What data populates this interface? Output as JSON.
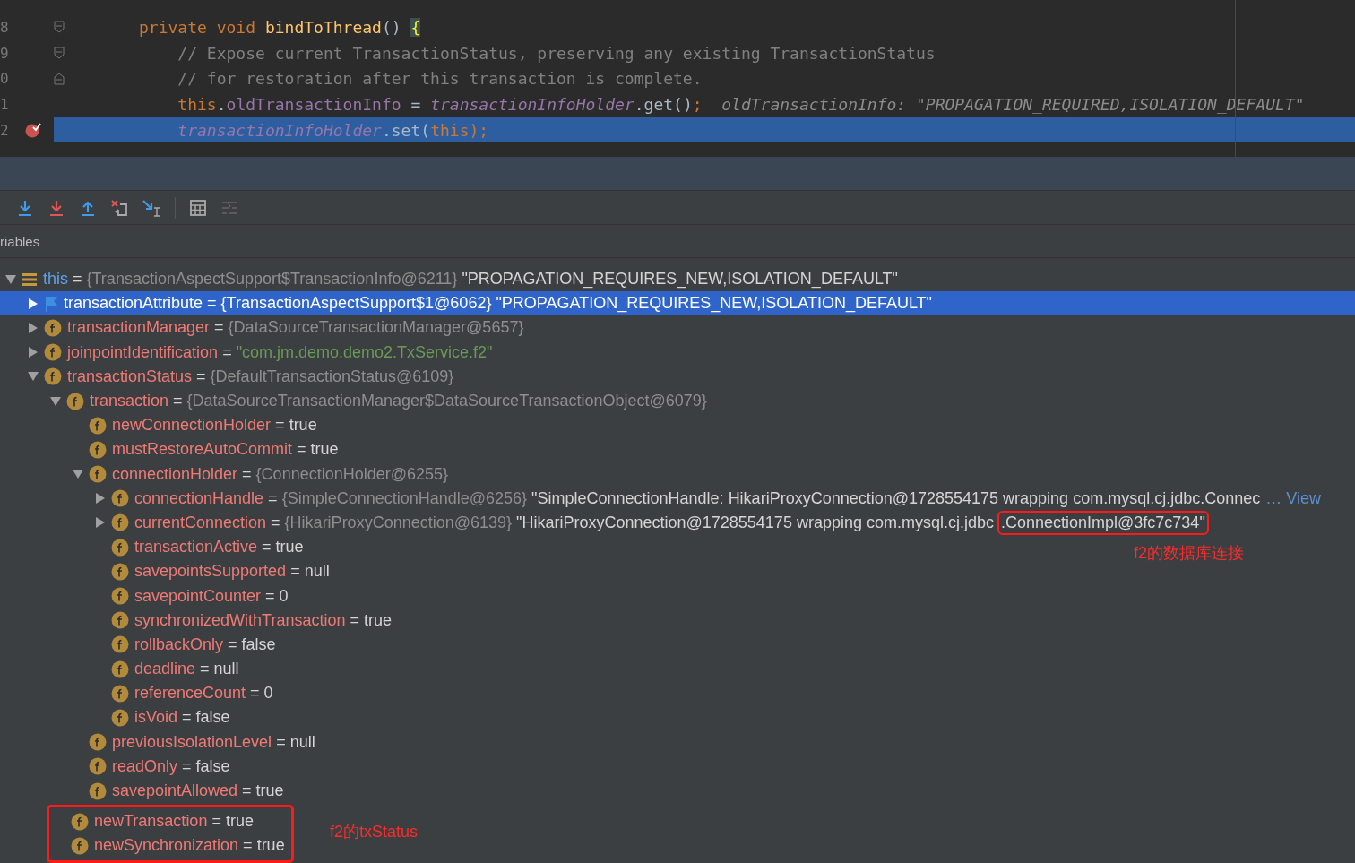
{
  "editor": {
    "lines": [
      {
        "number": "8",
        "selected": false,
        "fold_start": true,
        "tokens": [
          {
            "kind": "keyword",
            "text": "private void "
          },
          {
            "kind": "method",
            "text": "bindToThread"
          },
          {
            "kind": "plain",
            "text": "() "
          },
          {
            "kind": "brace",
            "text": "{"
          }
        ]
      },
      {
        "number": "9",
        "selected": false,
        "fold_start": true,
        "tokens": [
          {
            "kind": "comment",
            "text": "    // Expose current TransactionStatus, preserving any existing TransactionStatus"
          }
        ]
      },
      {
        "number": "0",
        "selected": false,
        "fold_end": true,
        "tokens": [
          {
            "kind": "comment",
            "text": "    // for restoration after this transaction is complete."
          }
        ]
      },
      {
        "number": "1",
        "selected": false,
        "tokens": [
          {
            "kind": "keyword",
            "text": "    this"
          },
          {
            "kind": "plain",
            "text": "."
          },
          {
            "kind": "field",
            "text": "oldTransactionInfo"
          },
          {
            "kind": "plain",
            "text": " = "
          },
          {
            "kind": "static",
            "text": "transactionInfoHolder"
          },
          {
            "kind": "plain",
            "text": ".get()"
          },
          {
            "kind": "keyword",
            "text": ";"
          },
          {
            "kind": "hint",
            "text": "  oldTransactionInfo: \"PROPAGATION_REQUIRED,ISOLATION_DEFAULT\""
          }
        ]
      },
      {
        "number": "2",
        "selected": true,
        "breakpoint": true,
        "tokens": [
          {
            "kind": "static",
            "text": "    transactionInfoHolder"
          },
          {
            "kind": "plain",
            "text": ".set("
          },
          {
            "kind": "keyword",
            "text": "this"
          },
          {
            "kind": "keyword",
            "text": ");"
          }
        ]
      }
    ]
  },
  "variables": {
    "header": "riables",
    "separator": "=",
    "tree": [
      {
        "kind": "local",
        "name": "this",
        "ref": "{TransactionAspectSupport$TransactionInfo@6211}",
        "value": "\"PROPAGATION_REQUIRES_NEW,ISOLATION_DEFAULT\"",
        "expanded": true,
        "selected": false,
        "children": [
          {
            "kind": "flag",
            "name": "transactionAttribute",
            "ref": "{TransactionAspectSupport$1@6062}",
            "value": "\"PROPAGATION_REQUIRES_NEW,ISOLATION_DEFAULT\"",
            "expanded": false,
            "selected": true
          },
          {
            "kind": "field",
            "name": "transactionManager",
            "ref": "{DataSourceTransactionManager@5657}",
            "expanded": false,
            "selected": false
          },
          {
            "kind": "field",
            "name": "joinpointIdentification",
            "string": "\"com.jm.demo.demo2.TxService.f2\"",
            "expanded": false,
            "selected": false
          },
          {
            "kind": "field",
            "name": "transactionStatus",
            "ref": "{DefaultTransactionStatus@6109}",
            "expanded": true,
            "selected": false,
            "children": [
              {
                "kind": "field",
                "name": "transaction",
                "ref": "{DataSourceTransactionManager$DataSourceTransactionObject@6079}",
                "expanded": true,
                "selected": false,
                "children": [
                  {
                    "kind": "field",
                    "name": "newConnectionHolder",
                    "value": "true",
                    "selected": false
                  },
                  {
                    "kind": "field",
                    "name": "mustRestoreAutoCommit",
                    "value": "true",
                    "selected": false
                  },
                  {
                    "kind": "field",
                    "name": "connectionHolder",
                    "ref": "{ConnectionHolder@6255}",
                    "expanded": true,
                    "selected": false,
                    "children": [
                      {
                        "kind": "field",
                        "name": "connectionHandle",
                        "ref": "{SimpleConnectionHandle@6256}",
                        "value": "\"SimpleConnectionHandle: HikariProxyConnection@1728554175 wrapping com.mysql.cj.jdbc.Connec",
                        "link": "… View",
                        "expanded": false,
                        "selected": false
                      },
                      {
                        "kind": "field",
                        "name": "currentConnection",
                        "ref": "{HikariProxyConnection@6139}",
                        "value": "\"HikariProxyConnection@1728554175 wrapping com.mysql.cj.jdbc",
                        "highlight": ".ConnectionImpl@3fc7c734\"",
                        "note": "f2的数据库连接",
                        "expanded": false,
                        "selected": false
                      },
                      {
                        "kind": "field",
                        "name": "transactionActive",
                        "value": "true",
                        "selected": false
                      },
                      {
                        "kind": "field",
                        "name": "savepointsSupported",
                        "value": "null",
                        "selected": false
                      },
                      {
                        "kind": "field",
                        "name": "savepointCounter",
                        "value": "0",
                        "selected": false
                      },
                      {
                        "kind": "field",
                        "name": "synchronizedWithTransaction",
                        "value": "true",
                        "selected": false
                      },
                      {
                        "kind": "field",
                        "name": "rollbackOnly",
                        "value": "false",
                        "selected": false
                      },
                      {
                        "kind": "field",
                        "name": "deadline",
                        "value": "null",
                        "selected": false
                      },
                      {
                        "kind": "field",
                        "name": "referenceCount",
                        "value": "0",
                        "selected": false
                      },
                      {
                        "kind": "field",
                        "name": "isVoid",
                        "value": "false",
                        "selected": false
                      }
                    ]
                  },
                  {
                    "kind": "field",
                    "name": "previousIsolationLevel",
                    "value": "null",
                    "selected": false
                  },
                  {
                    "kind": "field",
                    "name": "readOnly",
                    "value": "false",
                    "selected": false
                  },
                  {
                    "kind": "field",
                    "name": "savepointAllowed",
                    "value": "true",
                    "selected": false
                  }
                ]
              },
              {
                "kind": "group",
                "note": "f2的txStatus",
                "children": [
                  {
                    "kind": "field",
                    "name": "newTransaction",
                    "value": "true",
                    "selected": false
                  },
                  {
                    "kind": "field",
                    "name": "newSynchronization",
                    "value": "true",
                    "selected": false
                  }
                ]
              }
            ]
          }
        ]
      }
    ]
  }
}
